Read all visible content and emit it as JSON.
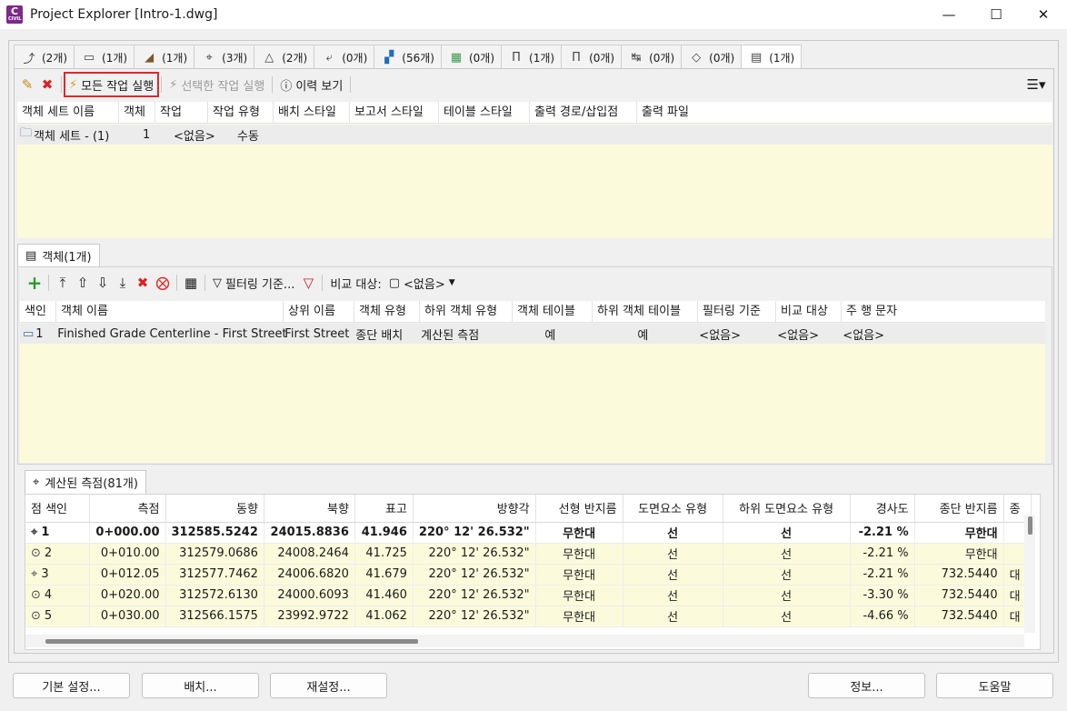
{
  "window": {
    "title": "Project Explorer [Intro-1.dwg]",
    "app_badge": "C",
    "app_badge_sub": "CIVIL"
  },
  "tabs": [
    {
      "icon": "alignment-icon",
      "label": "(2개)"
    },
    {
      "icon": "profile-icon",
      "label": "(1개)"
    },
    {
      "icon": "corridor-icon",
      "label": "(1개)"
    },
    {
      "icon": "assembly-icon",
      "label": "(3개)"
    },
    {
      "icon": "surface-icon",
      "label": "(2개)"
    },
    {
      "icon": "featureline-icon",
      "label": "(0개)"
    },
    {
      "icon": "pipe-icon",
      "label": "(56개)"
    },
    {
      "icon": "parcel-icon",
      "label": "(0개)"
    },
    {
      "icon": "structure-icon",
      "label": "(1개)"
    },
    {
      "icon": "structure2-icon",
      "label": "(0개)"
    },
    {
      "icon": "sample-icon",
      "label": "(0개)"
    },
    {
      "icon": "quantity-icon",
      "label": "(0개)"
    },
    {
      "icon": "document-icon",
      "label": "(1개)"
    }
  ],
  "toolbar": {
    "run_all": "모든 작업 실행",
    "run_selected": "선택한 작업 실행",
    "history": "이력 보기"
  },
  "sets_grid": {
    "columns": [
      "객체 세트 이름",
      "객체",
      "작업",
      "작업 유형",
      "배치 스타일",
      "보고서 스타일",
      "테이블 스타일",
      "출력 경로/삽입점",
      "출력 파일"
    ],
    "row": {
      "name": "객체 세트 - (1)",
      "objects": "1",
      "action": "<없음>",
      "action_type": "수동"
    }
  },
  "objects_section": {
    "tab_label": "객체(1개)",
    "filter_label": "필터링 기준...",
    "compare_label": "비교 대상:",
    "compare_value": "<없음>",
    "columns": [
      "색인",
      "객체 이름",
      "상위 이름",
      "객체 유형",
      "하위 객체 유형",
      "객체 테이블",
      "하위 객체 테이블",
      "필터링 기준",
      "비교 대상",
      "주 행 문자"
    ],
    "row": {
      "index": "1",
      "name": "Finished Grade Centerline - First Street",
      "parent": "First Street",
      "type": "종단 배치",
      "subtype": "계산된 측점",
      "object_table": "예",
      "subobject_table": "예",
      "filter": "<없음>",
      "compare": "<없음>",
      "header": "<없음>"
    }
  },
  "stations_section": {
    "tab_label": "계산된 측점(81개)",
    "columns": [
      "점 색인",
      "측점",
      "동향",
      "북향",
      "표고",
      "방향각",
      "선형 반지름",
      "도면요소 유형",
      "하위 도면요소 유형",
      "경사도",
      "종단 반지름",
      "종"
    ],
    "rows": [
      [
        "1",
        "0+000.00",
        "312585.5242",
        "24015.8836",
        "41.946",
        "220° 12' 26.532\"",
        "무한대",
        "선",
        "선",
        "-2.21 %",
        "무한대",
        ""
      ],
      [
        "2",
        "0+010.00",
        "312579.0686",
        "24008.2464",
        "41.725",
        "220° 12' 26.532\"",
        "무한대",
        "선",
        "선",
        "-2.21 %",
        "무한대",
        ""
      ],
      [
        "3",
        "0+012.05",
        "312577.7462",
        "24006.6820",
        "41.679",
        "220° 12' 26.532\"",
        "무한대",
        "선",
        "선",
        "-2.21 %",
        "732.5440",
        "대"
      ],
      [
        "4",
        "0+020.00",
        "312572.6130",
        "24000.6093",
        "41.460",
        "220° 12' 26.532\"",
        "무한대",
        "선",
        "선",
        "-3.30 %",
        "732.5440",
        "대"
      ],
      [
        "5",
        "0+030.00",
        "312566.1575",
        "23992.9722",
        "41.062",
        "220° 12' 26.532\"",
        "무한대",
        "선",
        "선",
        "-4.66 %",
        "732.5440",
        "대"
      ]
    ]
  },
  "footer": {
    "defaults": "기본 설정...",
    "layout": "배치...",
    "reset": "재설정...",
    "about": "정보...",
    "help": "도움말"
  }
}
